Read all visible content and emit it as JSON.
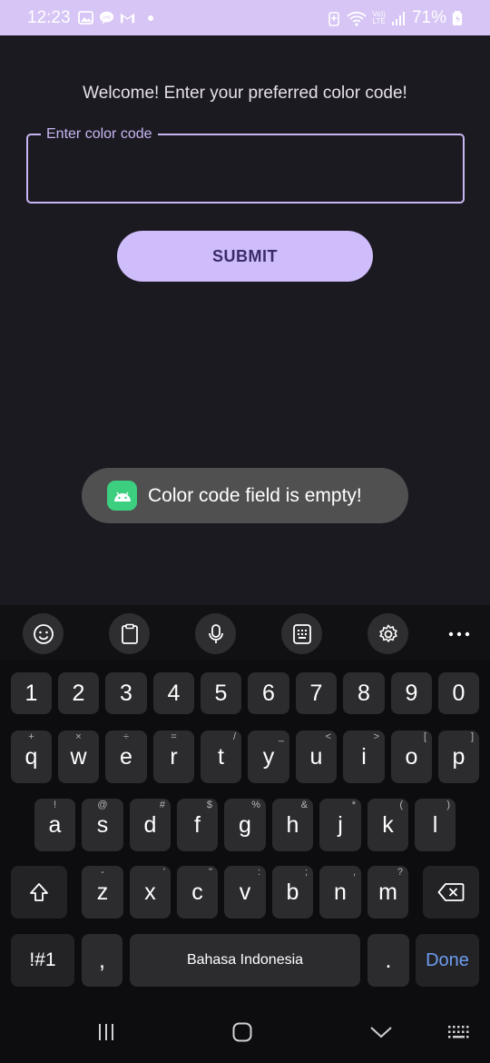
{
  "status_bar": {
    "time": "12:23",
    "battery_percent": "71%",
    "network_label_top": "Vo))",
    "network_label_bottom": "LTE",
    "left_icons": [
      "gallery-icon",
      "line-icon",
      "gmail-icon",
      "notification-dot"
    ],
    "right_icons": [
      "battery-saver-icon",
      "wifi-icon",
      "signal-icon",
      "battery-icon"
    ]
  },
  "app": {
    "welcome_text": "Welcome! Enter your preferred color code!",
    "field_label": "Enter color code",
    "field_value": "",
    "submit_label": "SUBMIT"
  },
  "toast": {
    "icon": "android-icon",
    "text": "Color code field is empty!"
  },
  "keyboard": {
    "toolbar": [
      "emoji-icon",
      "clipboard-icon",
      "microphone-icon",
      "keypad-icon",
      "settings-icon",
      "more-icon"
    ],
    "number_row": [
      "1",
      "2",
      "3",
      "4",
      "5",
      "6",
      "7",
      "8",
      "9",
      "0"
    ],
    "row1": [
      {
        "key": "q",
        "hint": "+"
      },
      {
        "key": "w",
        "hint": "×"
      },
      {
        "key": "e",
        "hint": "÷"
      },
      {
        "key": "r",
        "hint": "="
      },
      {
        "key": "t",
        "hint": "/"
      },
      {
        "key": "y",
        "hint": "_"
      },
      {
        "key": "u",
        "hint": "<"
      },
      {
        "key": "i",
        "hint": ">"
      },
      {
        "key": "o",
        "hint": "["
      },
      {
        "key": "p",
        "hint": "]"
      }
    ],
    "row2": [
      {
        "key": "a",
        "hint": "!"
      },
      {
        "key": "s",
        "hint": "@"
      },
      {
        "key": "d",
        "hint": "#"
      },
      {
        "key": "f",
        "hint": "$"
      },
      {
        "key": "g",
        "hint": "%"
      },
      {
        "key": "h",
        "hint": "&"
      },
      {
        "key": "j",
        "hint": "*"
      },
      {
        "key": "k",
        "hint": "("
      },
      {
        "key": "l",
        "hint": ")"
      }
    ],
    "row3": [
      {
        "key": "z",
        "hint": "-"
      },
      {
        "key": "x",
        "hint": "'"
      },
      {
        "key": "c",
        "hint": "\""
      },
      {
        "key": "v",
        "hint": ":"
      },
      {
        "key": "b",
        "hint": ";"
      },
      {
        "key": "n",
        "hint": ","
      },
      {
        "key": "m",
        "hint": "?"
      }
    ],
    "symbols_label": "!#1",
    "comma_label": ",",
    "space_label": "Bahasa Indonesia",
    "period_label": ".",
    "done_label": "Done"
  },
  "nav": [
    "recents-icon",
    "home-icon",
    "back-icon",
    "keyboard-switch-icon"
  ],
  "colors": {
    "background": "#1c1a21",
    "accent": "#cfbcfa",
    "status_bar": "#d6c5f5",
    "toast_bg": "#505050",
    "done_blue": "#6e9df0"
  }
}
